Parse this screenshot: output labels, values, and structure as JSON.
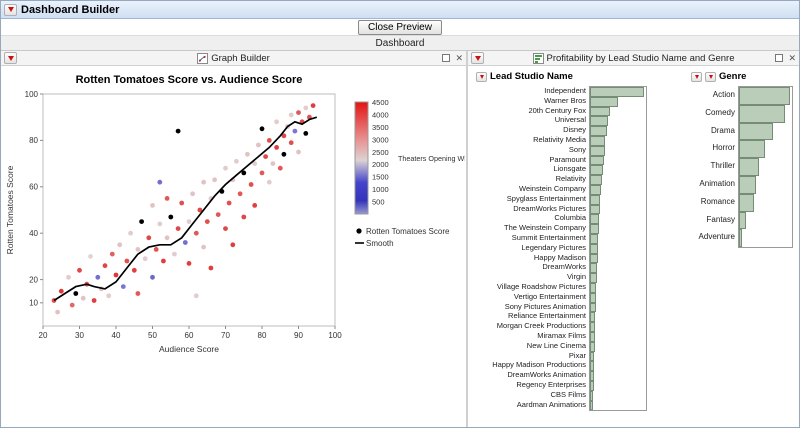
{
  "window": {
    "title": "Dashboard Builder"
  },
  "toolbar": {
    "close_preview_label": "Close Preview"
  },
  "tab": {
    "label": "Dashboard"
  },
  "panels": {
    "graph_builder": {
      "title": "Graph Builder"
    },
    "profitability": {
      "title": "Profitability by Lead Studio Name and Genre"
    }
  },
  "colors": {
    "accent_red": "#cf1010",
    "bar_fill": "#b9cdb9",
    "bar_border": "#748d74",
    "smooth_line": "#000000",
    "point_black": "#000000"
  },
  "chart_data": [
    {
      "type": "scatter",
      "title": "Rotten Tomatoes Score vs. Audience Score",
      "xlabel": "Audience Score",
      "ylabel": "Rotten Tomatoes Score",
      "xlim": [
        20,
        100
      ],
      "ylim": [
        0,
        100
      ],
      "xticks": [
        20,
        30,
        40,
        50,
        60,
        70,
        80,
        90,
        100
      ],
      "yticks": [
        10,
        20,
        40,
        60,
        80,
        100
      ],
      "color_legend": {
        "title": "Theaters Opening Wknd",
        "min": 0,
        "max": 4500,
        "ticks": [
          4500,
          4000,
          3500,
          3000,
          2500,
          2000,
          1500,
          1000,
          500
        ],
        "gradient_stops": [
          [
            "0",
            "#e31313"
          ],
          [
            "0.33",
            "#e88f8f"
          ],
          [
            "0.52",
            "#ddd3d3"
          ],
          [
            "0.72",
            "#4444cc"
          ],
          [
            "0.88",
            "#3333bb"
          ],
          [
            "1",
            "#9a9ad0"
          ]
        ]
      },
      "legend": [
        {
          "label": "Rotten Tomatoes Score",
          "marker": "dot"
        },
        {
          "label": "Smooth",
          "marker": "line"
        }
      ],
      "points": [
        [
          23,
          11,
          3900
        ],
        [
          24,
          6,
          2500
        ],
        [
          25,
          15,
          4200
        ],
        [
          27,
          21,
          2400
        ],
        [
          28,
          9,
          3600
        ],
        [
          29,
          14,
          null
        ],
        [
          30,
          24,
          4000
        ],
        [
          31,
          12,
          2500
        ],
        [
          32,
          18,
          3900
        ],
        [
          33,
          30,
          2300
        ],
        [
          34,
          11,
          4100
        ],
        [
          35,
          21,
          800
        ],
        [
          36,
          16,
          2500
        ],
        [
          37,
          26,
          4000
        ],
        [
          38,
          13,
          2400
        ],
        [
          39,
          31,
          3700
        ],
        [
          40,
          22,
          4200
        ],
        [
          41,
          35,
          2500
        ],
        [
          42,
          17,
          900
        ],
        [
          43,
          28,
          3900
        ],
        [
          44,
          40,
          2400
        ],
        [
          45,
          24,
          4100
        ],
        [
          46,
          33,
          2500
        ],
        [
          46,
          14,
          3800
        ],
        [
          47,
          45,
          null
        ],
        [
          48,
          29,
          2400
        ],
        [
          49,
          38,
          4000
        ],
        [
          50,
          21,
          700
        ],
        [
          50,
          52,
          2500
        ],
        [
          51,
          33,
          3900
        ],
        [
          52,
          44,
          2400
        ],
        [
          52,
          62,
          800
        ],
        [
          53,
          28,
          4100
        ],
        [
          54,
          38,
          2500
        ],
        [
          54,
          55,
          3800
        ],
        [
          55,
          47,
          null
        ],
        [
          56,
          31,
          2400
        ],
        [
          57,
          42,
          4000
        ],
        [
          57,
          84,
          null
        ],
        [
          58,
          53,
          3900
        ],
        [
          59,
          36,
          800
        ],
        [
          60,
          45,
          2400
        ],
        [
          60,
          27,
          4100
        ],
        [
          61,
          57,
          2500
        ],
        [
          62,
          40,
          3800
        ],
        [
          62,
          13,
          2400
        ],
        [
          63,
          50,
          4000
        ],
        [
          64,
          34,
          2500
        ],
        [
          64,
          62,
          2500
        ],
        [
          65,
          45,
          3900
        ],
        [
          66,
          55,
          2400
        ],
        [
          66,
          25,
          4100
        ],
        [
          67,
          63,
          2500
        ],
        [
          68,
          48,
          3800
        ],
        [
          69,
          58,
          null
        ],
        [
          70,
          42,
          4000
        ],
        [
          70,
          68,
          2400
        ],
        [
          71,
          53,
          3900
        ],
        [
          72,
          63,
          2500
        ],
        [
          72,
          35,
          4100
        ],
        [
          73,
          71,
          2400
        ],
        [
          74,
          57,
          3800
        ],
        [
          75,
          66,
          null
        ],
        [
          75,
          47,
          4000
        ],
        [
          76,
          74,
          2500
        ],
        [
          77,
          61,
          3900
        ],
        [
          78,
          70,
          2400
        ],
        [
          78,
          52,
          4100
        ],
        [
          79,
          78,
          2500
        ],
        [
          80,
          66,
          3800
        ],
        [
          80,
          85,
          null
        ],
        [
          81,
          73,
          4000
        ],
        [
          82,
          62,
          2400
        ],
        [
          82,
          80,
          3900
        ],
        [
          83,
          70,
          2500
        ],
        [
          84,
          77,
          4100
        ],
        [
          84,
          88,
          2400
        ],
        [
          85,
          68,
          3800
        ],
        [
          86,
          82,
          4000
        ],
        [
          86,
          74,
          null
        ],
        [
          87,
          86,
          2500
        ],
        [
          88,
          79,
          3900
        ],
        [
          88,
          91,
          2400
        ],
        [
          89,
          84,
          900
        ],
        [
          90,
          92,
          3800
        ],
        [
          90,
          75,
          2500
        ],
        [
          91,
          88,
          4000
        ],
        [
          92,
          94,
          2400
        ],
        [
          92,
          83,
          null
        ],
        [
          93,
          90,
          3900
        ],
        [
          94,
          95,
          4100
        ]
      ],
      "smooth": [
        [
          23,
          11
        ],
        [
          26,
          14
        ],
        [
          29,
          17
        ],
        [
          32,
          18
        ],
        [
          34,
          17
        ],
        [
          37,
          16
        ],
        [
          40,
          19
        ],
        [
          43,
          25
        ],
        [
          46,
          31
        ],
        [
          49,
          34
        ],
        [
          52,
          35
        ],
        [
          55,
          35
        ],
        [
          58,
          38
        ],
        [
          61,
          44
        ],
        [
          64,
          50
        ],
        [
          67,
          56
        ],
        [
          70,
          61
        ],
        [
          73,
          65
        ],
        [
          76,
          69
        ],
        [
          79,
          73
        ],
        [
          82,
          77
        ],
        [
          85,
          82
        ],
        [
          87,
          86
        ],
        [
          89,
          88
        ],
        [
          91,
          87
        ],
        [
          93,
          89
        ],
        [
          95,
          90
        ]
      ]
    },
    {
      "type": "bar",
      "orientation": "horizontal",
      "title": "Lead Studio Name",
      "categories": [
        "Independent",
        "Warner Bros",
        "20th Century Fox",
        "Universal",
        "Disney",
        "Relativity Media",
        "Sony",
        "Paramount",
        "Lionsgate",
        "Relativity",
        "Weinstein Company",
        "Spyglass Entertainment",
        "DreamWorks Pictures",
        "Columbia",
        "The Weinstein Company",
        "Summit Entertainment",
        "Legendary Pictures",
        "Happy Madison",
        "DreamWorks",
        "Virgin",
        "Village Roadshow Pictures",
        "Vertigo Entertainment",
        "Sony Pictures Animation",
        "Reliance Entertainment",
        "Morgan Creek Productions",
        "Miramax Films",
        "New Line Cinema",
        "Pixar",
        "Happy Madison Productions",
        "DreamWorks Animation",
        "Regency Enterprises",
        "CBS Films",
        "Aardman Animations"
      ],
      "values": [
        54,
        28,
        20,
        18,
        17,
        15,
        15,
        14,
        13,
        12,
        11,
        10,
        10,
        9,
        9,
        8,
        8,
        8,
        7,
        7,
        6,
        6,
        6,
        5,
        5,
        5,
        5,
        4,
        4,
        4,
        4,
        3,
        3
      ]
    },
    {
      "type": "bar",
      "orientation": "horizontal",
      "title": "Genre",
      "categories": [
        "Action",
        "Comedy",
        "Drama",
        "Horror",
        "Thriller",
        "Animation",
        "Romance",
        "Fantasy",
        "Adventure"
      ],
      "values": [
        30,
        27,
        20,
        15,
        12,
        10,
        9,
        4,
        2
      ]
    }
  ]
}
